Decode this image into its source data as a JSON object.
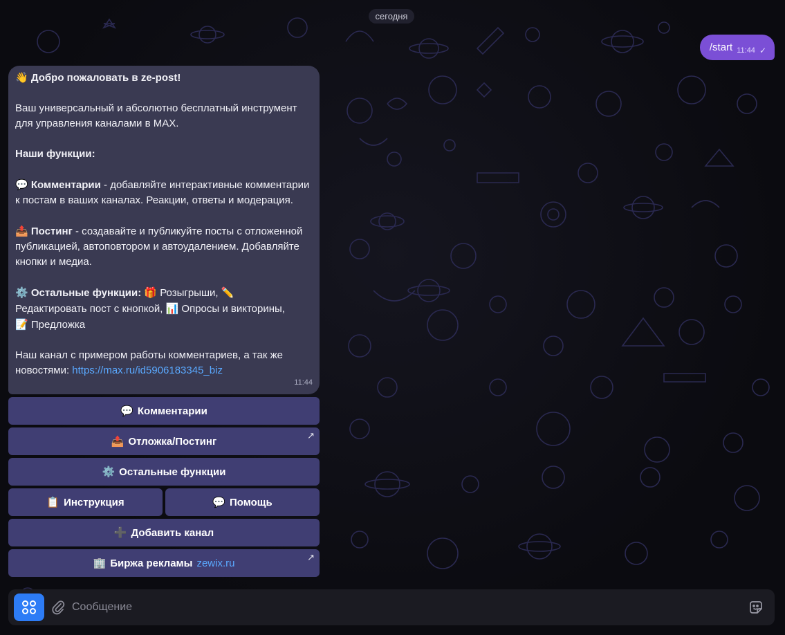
{
  "chat": {
    "date_label": "сегодня",
    "outgoing": {
      "text": "/start",
      "time": "11:44",
      "status_icon": "double-check-icon"
    },
    "incoming": {
      "title_emoji": "👋",
      "title": "Добро пожаловать в ze-post!",
      "intro": "Ваш универсальный и абсолютно бесплатный инструмент для управления каналами в MAX.",
      "features_heading": "Наши функции:",
      "comments_emoji": "💬",
      "comments_title": "Комментарии",
      "comments_text": " - добавляйте интерактивные комментарии к постам в ваших каналах. Реакции, ответы и модерация.",
      "posting_emoji": "📤",
      "posting_title": "Постинг",
      "posting_text": " - создавайте и публикуйте посты с отложенной публикацией, автоповтором и автоудалением. Добавляйте кнопки и медиа.",
      "other_emoji": "⚙️",
      "other_title": "Остальные функции:",
      "other_gift_emoji": "🎁",
      "other_item1": " Розыгрыши,",
      "other_pencil_emoji": "✏️",
      "other_item2": "Редактировать пост с кнопкой,",
      "other_chart_emoji": "📊",
      "other_item3": " Опросы и викторины,",
      "other_memo_emoji": "📝",
      "other_item4": " Предложка",
      "channel_text": "Наш канал с примером работы комментариев, а так же новостями: ",
      "channel_link": "https://max.ru/id5906183345_biz",
      "time": "11:44"
    }
  },
  "keyboard": {
    "comments": {
      "emoji": "💬",
      "label": "Комментарии"
    },
    "posting": {
      "emoji": "📤",
      "label": "Отложка/Постинг",
      "external": "↗"
    },
    "other": {
      "emoji": "⚙️",
      "label": "Остальные функции"
    },
    "instruction": {
      "emoji": "📋",
      "label": "Инструкция"
    },
    "help": {
      "emoji": "💬",
      "label": "Помощь"
    },
    "add_channel": {
      "emoji": "➕",
      "label": "Добавить канал"
    },
    "exchange": {
      "emoji": "🏢",
      "label": "Биржа рекламы",
      "link": "zewix.ru",
      "external": "↗"
    }
  },
  "composer": {
    "placeholder": "Сообщение",
    "apps_icon": "apps-grid-icon",
    "attach_icon": "paperclip-icon",
    "sticker_icon": "sticker-icon"
  },
  "colors": {
    "accent": "#7b4fd6",
    "incoming_bubble": "#3a3a52",
    "keyboard_button": "#403e73",
    "link": "#5aa9ff",
    "apps_button": "#2d7cf6"
  }
}
